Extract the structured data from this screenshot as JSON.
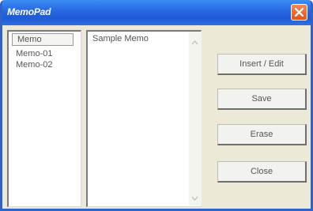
{
  "window": {
    "title": "MemoPad"
  },
  "memo_list": {
    "header": "Memo",
    "items": [
      "Memo-01",
      "Memo-02"
    ]
  },
  "memo_editor": {
    "content": "Sample Memo"
  },
  "buttons": {
    "insert_edit": "Insert / Edit",
    "save": "Save",
    "erase": "Erase",
    "close": "Close"
  },
  "icons": {
    "title_close": "close-icon",
    "scroll_up": "scroll-up-icon",
    "scroll_down": "scroll-down-icon"
  },
  "colors": {
    "titlebar": "#2a6ee3",
    "close_button": "#e0541c",
    "window_bg": "#ece9d8"
  }
}
